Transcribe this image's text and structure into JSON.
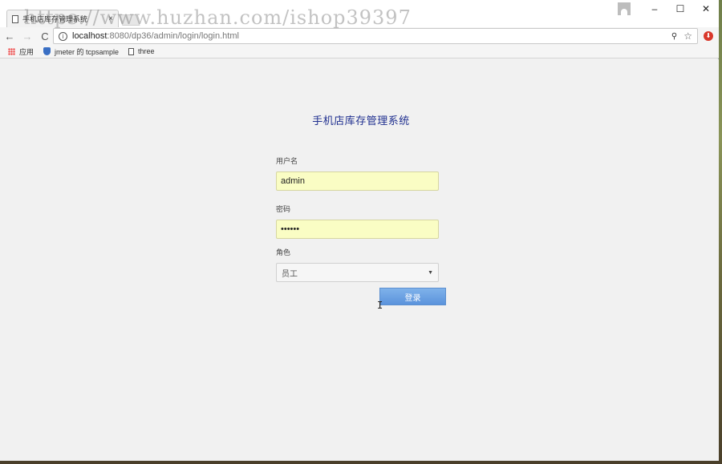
{
  "browser": {
    "tab_title": "手机店库存管理系统",
    "tab_close": "×",
    "window_controls": {
      "minimize": "–",
      "maximize": "☐",
      "close": "✕"
    },
    "nav": {
      "back": "←",
      "forward": "→",
      "reload": "C"
    },
    "url_host": "localhost",
    "url_path": ":8080/dp36/admin/login/login.html",
    "bookmarks": [
      {
        "label": "应用",
        "icon": "apps-icon"
      },
      {
        "label": "jmeter 的 tcpsample",
        "icon": "shield-icon"
      },
      {
        "label": "three",
        "icon": "doc-icon"
      }
    ]
  },
  "watermark": "https://www.huzhan.com/ishop39397",
  "page": {
    "title": "手机店库存管理系统",
    "username": {
      "label": "用户名",
      "value": "admin"
    },
    "password": {
      "label": "密码",
      "value": "••••••"
    },
    "role": {
      "label": "角色",
      "selected": "员工"
    },
    "login_button": "登录"
  },
  "colors": {
    "title": "#1f2f8f",
    "input_autofill": "#fafdc4",
    "button": "#6aa2e4"
  }
}
